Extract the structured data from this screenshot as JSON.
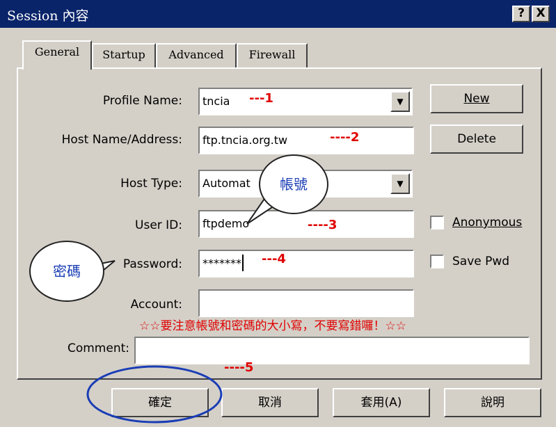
{
  "window": {
    "title": "Session 內容",
    "help": "?",
    "close": "X"
  },
  "tabs": [
    "General",
    "Startup",
    "Advanced",
    "Firewall"
  ],
  "form": {
    "profile_name_label": "Profile Name:",
    "profile_name_value": "tncia",
    "host_label": "Host Name/Address:",
    "host_value": "ftp.tncia.org.tw",
    "host_type_label": "Host Type:",
    "host_type_value": "Automat",
    "user_label": "User ID:",
    "user_value": "ftpdemo",
    "password_label": "Password:",
    "password_value": "*******",
    "account_label": "Account:",
    "account_value": "",
    "comment_label": "Comment:",
    "comment_value": ""
  },
  "side": {
    "new": "New",
    "delete": "Delete",
    "anonymous": "Anonymous",
    "save_pwd": "Save Pwd"
  },
  "annotations": {
    "n1": "---1",
    "n2": "----2",
    "n3": "----3",
    "n4": "---4",
    "n5": "----5",
    "bubble_account": "帳號",
    "bubble_password": "密碼",
    "note": "☆☆要注意帳號和密碼的大小寫，不要寫錯囉！☆☆"
  },
  "footer": {
    "ok": "確定",
    "cancel": "取消",
    "apply": "套用(A)",
    "help": "說明"
  },
  "colors": {
    "title_bar": "#0a246a",
    "annotation_red": "#e00000",
    "ellipse_blue": "#1a3db5"
  }
}
